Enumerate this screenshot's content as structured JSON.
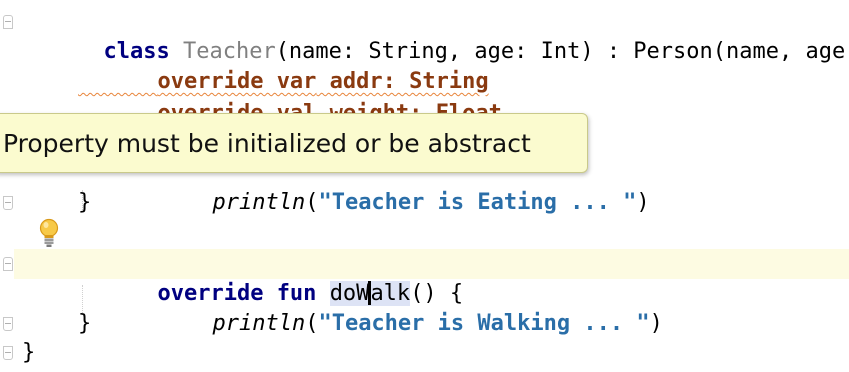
{
  "editor": {
    "lines": {
      "class_decl": {
        "kw_class": "class",
        "name": "Teacher",
        "rest": "(name: String, age: Int) : Person(name, age) {"
      },
      "addr": {
        "kw": "override var",
        "text": " addr: String"
      },
      "weight": {
        "kw": "override val",
        "text": " weight: Float"
      },
      "eat_println": {
        "fn": "println",
        "open": "(",
        "str": "\"Teacher is Eating ... \"",
        "close": ")"
      },
      "eat_close": "}",
      "walk_decl": {
        "kw": "override fun",
        "name_a": "doW",
        "name_b": "alk",
        "rest": "() {"
      },
      "walk_println": {
        "fn": "println",
        "open": "(",
        "str": "\"Teacher is Walking ... \"",
        "close": ")"
      },
      "walk_close": "}",
      "class_close": "}"
    },
    "tooltip": "Property must be initialized or be abstract",
    "colors": {
      "keyword": "#000080",
      "string": "#2a6ea8",
      "warning_underline": "#e8853b",
      "tooltip_bg": "#fbfbcf",
      "current_line": "#fdfbe2"
    },
    "icons": {
      "intention": "lightbulb-icon"
    }
  }
}
